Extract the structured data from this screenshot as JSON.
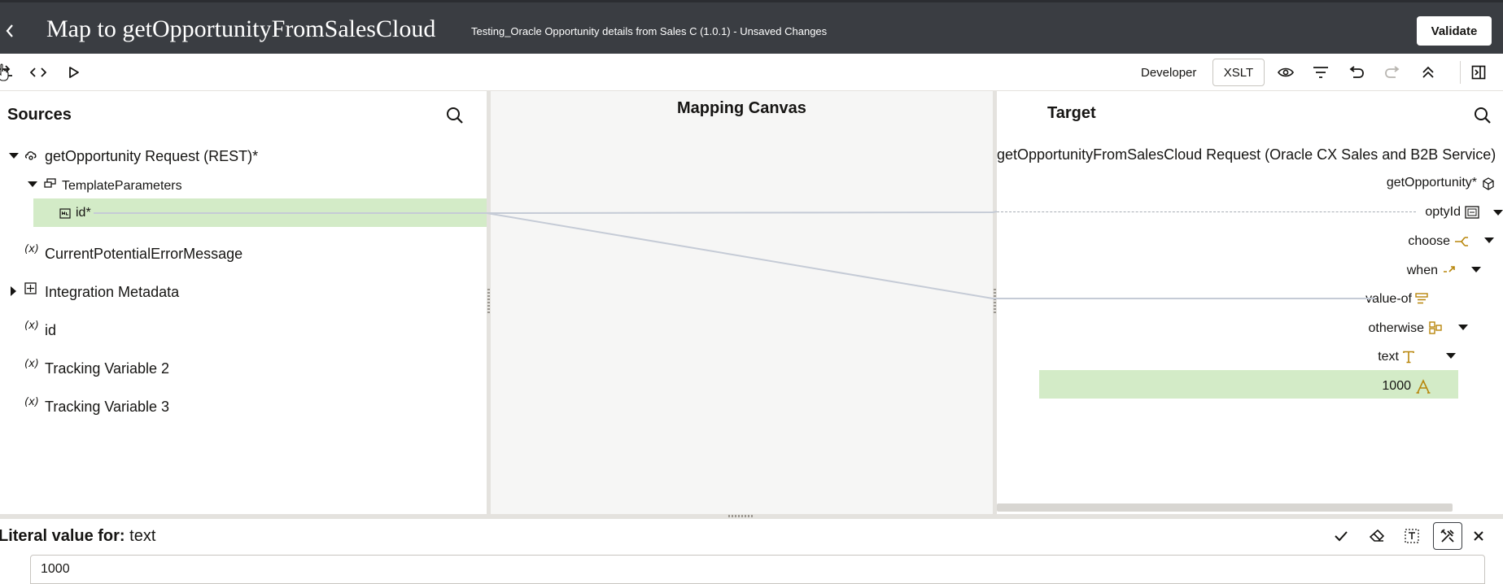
{
  "header": {
    "title": "Map to getOpportunityFromSalesCloud",
    "subtitle": "Testing_Oracle Opportunity details from Sales C (1.0.1) - Unsaved Changes",
    "validate_label": "Validate"
  },
  "toolbar": {
    "developer_label": "Developer",
    "xslt_label": "XSLT"
  },
  "sources": {
    "heading": "Sources",
    "tree": {
      "root": "getOpportunity Request (REST)*",
      "template_parameters": "TemplateParameters",
      "id_param": "id*",
      "current_error": "CurrentPotentialErrorMessage",
      "integration_metadata": "Integration Metadata",
      "id_var": "id",
      "tracking2": "Tracking Variable 2",
      "tracking3": "Tracking Variable 3"
    },
    "var_glyph": "(x)"
  },
  "canvas": {
    "heading": "Mapping Canvas"
  },
  "target": {
    "heading": "Target",
    "tree": {
      "root": "getOpportunityFromSalesCloud Request (Oracle CX Sales and B2B Service)",
      "get_opportunity": "getOpportunity*",
      "opty_id": "optyId",
      "choose": "choose",
      "when": "when",
      "value_of": "value-of",
      "otherwise": "otherwise",
      "text": "text",
      "literal": "1000"
    }
  },
  "literal_editor": {
    "label_prefix": "Literal value for:",
    "label_target": "text",
    "value": "1000"
  },
  "colors": {
    "header_bg": "#3a3d42",
    "highlight": "#d3ebc7",
    "xsl_icon": "#b8860b",
    "mapping_line": "#c5cbd6"
  }
}
